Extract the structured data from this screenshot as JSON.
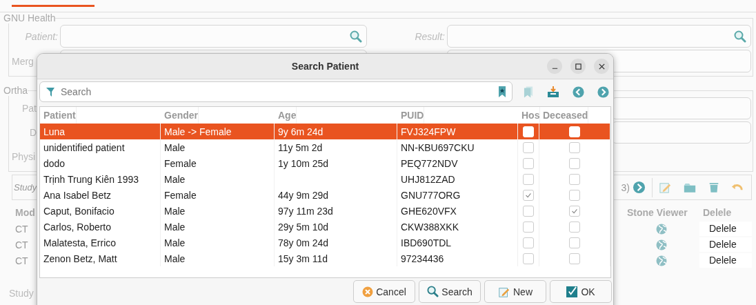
{
  "background": {
    "gnu_health": {
      "legend": "GNU Health",
      "patient_label": "Patient:",
      "result_label": "Result:",
      "merge_label": "Merg"
    },
    "orthanc": {
      "legend": "Ortha",
      "labels": [
        "Pat",
        "D",
        "Physi"
      ]
    },
    "study_toolbar": {
      "placeholder": "Study",
      "page": "3)"
    },
    "study_table": {
      "columns": [
        "Mod",
        "Stone Viewer",
        "Delele"
      ],
      "rows": [
        {
          "modality": "CT",
          "delete": "Delele"
        },
        {
          "modality": "CT",
          "delete": "Delele"
        },
        {
          "modality": "CT",
          "delete": "Delele"
        }
      ]
    },
    "study_legend": "Study"
  },
  "dialog": {
    "title": "Search Patient",
    "search": {
      "placeholder": "Search"
    },
    "columns": [
      "Patient",
      "Gender",
      "Age",
      "PUID",
      "Hos",
      "Deceased"
    ],
    "rows": [
      {
        "patient": "Luna",
        "gender": "Male -> Female",
        "age": "9y 6m 24d",
        "puid": "FVJ324FPW",
        "column_5": false,
        "deceased": false,
        "selected": true
      },
      {
        "patient": "unidentified patient",
        "gender": "Male",
        "age": "11y 5m 2d",
        "puid": "NN-KBU697CKU",
        "column_5": false,
        "deceased": false,
        "selected": false
      },
      {
        "patient": "dodo",
        "gender": "Female",
        "age": "1y 10m 25d",
        "puid": "PEQ772NDV",
        "column_5": false,
        "deceased": false,
        "selected": false
      },
      {
        "patient": "Trịnh Trung Kiên 1993",
        "gender": "Male",
        "puid": "UHJ812ZAD",
        "column_5": false,
        "deceased": false,
        "selected": false
      },
      {
        "patient": "Ana Isabel Betz",
        "gender": "Female",
        "age": "44y 9m 29d",
        "puid": "GNU777ORG",
        "column_5": true,
        "deceased": false,
        "selected": false
      },
      {
        "patient": "Caput, Bonifacio",
        "gender": "Male",
        "age": "97y 11m 23d",
        "puid": "GHE620VFX",
        "column_5": false,
        "deceased": true,
        "selected": false
      },
      {
        "patient": "Carlos, Roberto",
        "gender": "Male",
        "age": "29y 5m 10d",
        "puid": "CKW388XKK",
        "column_5": false,
        "deceased": false,
        "selected": false
      },
      {
        "patient": "Malatesta, Errico",
        "gender": "Male",
        "age": "78y 0m 24d",
        "puid": "IBD690TDL",
        "column_5": false,
        "deceased": false,
        "selected": false
      },
      {
        "patient": "Zenon Betz, Matt",
        "gender": "Male",
        "age": "15y 3m 11d",
        "puid": "97234436",
        "column_5": false,
        "deceased": false,
        "selected": false
      }
    ],
    "buttons": [
      {
        "label": "Cancel",
        "kind": "cancel"
      },
      {
        "label": "Search",
        "kind": "search"
      },
      {
        "label": "New",
        "kind": "new"
      },
      {
        "label": "OK",
        "kind": "ok"
      }
    ]
  }
}
